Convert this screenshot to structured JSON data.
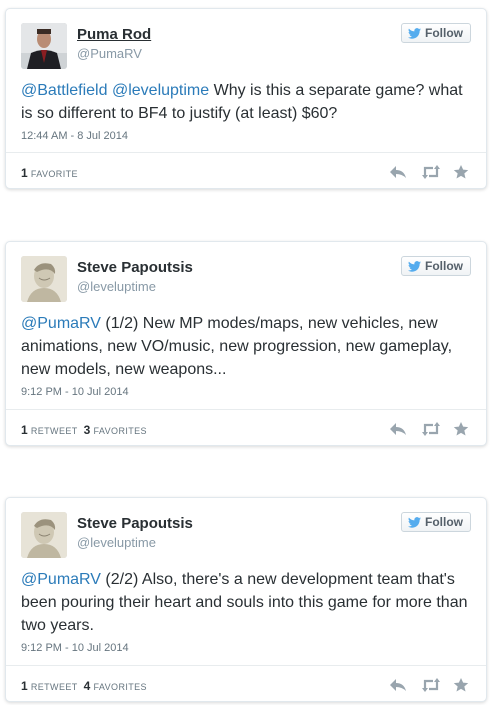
{
  "follow_label": "Follow",
  "tweets": [
    {
      "name": "Puma Rod",
      "handle": "@PumaRV",
      "text_parts": [
        "@Battlefield",
        " ",
        "@leveluptime",
        " Why is this a separate game? what is so different to BF4 to justify (at least) $60?"
      ],
      "time": "12:44 AM - 8 Jul 2014",
      "favorites_count": "1",
      "favorites_label": "Favorite"
    },
    {
      "name": "Steve Papoutsis",
      "handle": "@leveluptime",
      "text_parts": [
        "@PumaRV",
        " (1/2) New MP modes/maps, new vehicles, new animations, new VO/music, new progression, new gameplay, new models, new weapons..."
      ],
      "time": "9:12 PM - 10 Jul 2014",
      "retweets_count": "1",
      "retweets_label": "Retweet",
      "favorites_count": "3",
      "favorites_label": "Favorites"
    },
    {
      "name": "Steve Papoutsis",
      "handle": "@leveluptime",
      "text_parts": [
        "@PumaRV",
        " (2/2) Also, there's a new development team that's been pouring their heart and souls into this game for more than two years."
      ],
      "time": "9:12 PM - 10 Jul 2014",
      "retweets_count": "1",
      "retweets_label": "Retweet",
      "favorites_count": "4",
      "favorites_label": "Favorites"
    }
  ],
  "colors": {
    "mention": "#2b7bb9",
    "bird": "#55acee",
    "action": "#99a5ae"
  },
  "icons": [
    "twitter-bird-icon",
    "reply-icon",
    "retweet-icon",
    "favorite-star-icon"
  ]
}
